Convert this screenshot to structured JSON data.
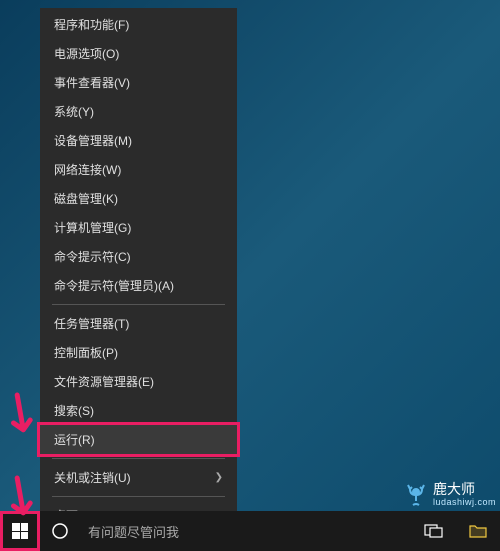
{
  "menu": {
    "items": [
      {
        "label": "程序和功能(F)"
      },
      {
        "label": "电源选项(O)"
      },
      {
        "label": "事件查看器(V)"
      },
      {
        "label": "系统(Y)"
      },
      {
        "label": "设备管理器(M)"
      },
      {
        "label": "网络连接(W)"
      },
      {
        "label": "磁盘管理(K)"
      },
      {
        "label": "计算机管理(G)"
      },
      {
        "label": "命令提示符(C)"
      },
      {
        "label": "命令提示符(管理员)(A)"
      }
    ],
    "items2": [
      {
        "label": "任务管理器(T)"
      },
      {
        "label": "控制面板(P)"
      },
      {
        "label": "文件资源管理器(E)"
      },
      {
        "label": "搜索(S)"
      },
      {
        "label": "运行(R)",
        "highlighted": true
      }
    ],
    "items3": [
      {
        "label": "关机或注销(U)",
        "submenu": true
      }
    ],
    "items4": [
      {
        "label": "桌面(D)"
      }
    ]
  },
  "taskbar": {
    "search_placeholder": "有问题尽管问我"
  },
  "watermark": {
    "title": "鹿大师",
    "subtitle": "ludashiwj.com"
  },
  "highlight_color": "#e91e63"
}
